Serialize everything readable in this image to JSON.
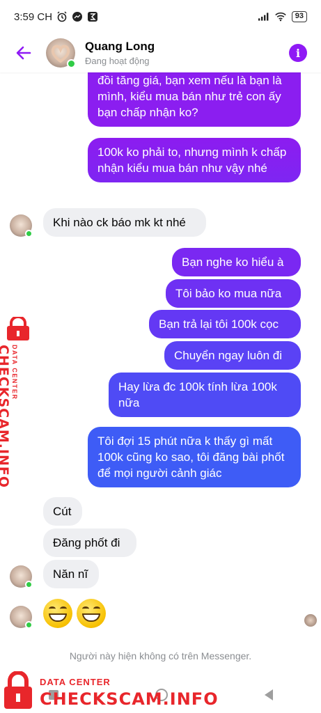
{
  "status_bar": {
    "time": "3:59 CH",
    "battery": "93"
  },
  "header": {
    "name": "Quang Long",
    "status": "Đang hoạt động"
  },
  "messages": [
    {
      "side": "out",
      "text": "đồi tăng giá, bạn xem nếu là bạn là mình, kiểu mua bán như trẻ con ấy bạn chấp nhận ko?"
    },
    {
      "side": "out",
      "text": "100k ko phải to, nhưng mình k chấp nhận kiểu mua bán như vậy nhé"
    },
    {
      "side": "in",
      "text": "Khi nào ck báo mk kt nhé"
    },
    {
      "side": "out",
      "text": "Bạn nghe ko hiểu à"
    },
    {
      "side": "out",
      "text": "Tôi bảo ko mua nữa"
    },
    {
      "side": "out",
      "text": "Bạn trả lại tôi 100k cọc"
    },
    {
      "side": "out",
      "text": "Chuyển ngay luôn đi"
    },
    {
      "side": "out",
      "text": "Hay lừa đc 100k tính lừa 100k nữa"
    },
    {
      "side": "out",
      "text": "Tôi đợi 15 phút nữa k thấy gì mất 100k cũng ko sao, tôi đăng bài phốt để mọi người cảnh giác"
    },
    {
      "side": "in",
      "text": "Cút"
    },
    {
      "side": "in",
      "text": "Đăng phốt đi"
    },
    {
      "side": "in",
      "text": "Năn nĩ"
    },
    {
      "side": "in",
      "emoji": "grinning-squinting-face x2"
    }
  ],
  "footer_note": "Người này hiện không có trên Messenger.",
  "watermark": {
    "small": "DATA CENTER",
    "big": "CHECKSCAM.INFO"
  },
  "colors": {
    "accent": "#8f1af5",
    "bubble_top": "#8b1ef0",
    "bubble_bottom": "#3b6af5",
    "online": "#31cc46",
    "watermark": "#e8262b"
  }
}
